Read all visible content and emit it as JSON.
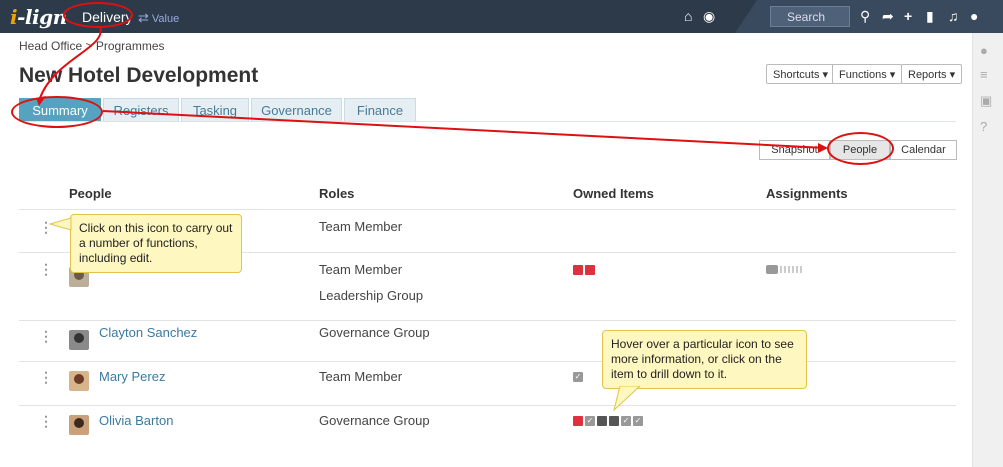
{
  "topbar": {
    "logo_prefix": "i",
    "logo_text": "-lign",
    "mode": "Delivery",
    "value_toggle": "Value",
    "search_placeholder": "Search"
  },
  "breadcrumb": "Head Office > Programmes",
  "page_title": "New Hotel Development",
  "menus": {
    "shortcuts": "Shortcuts ▾",
    "functions": "Functions ▾",
    "reports": "Reports ▾"
  },
  "tabs": [
    {
      "label": "Summary",
      "active": true
    },
    {
      "label": "Registers",
      "active": false
    },
    {
      "label": "Tasking",
      "active": false
    },
    {
      "label": "Governance",
      "active": false
    },
    {
      "label": "Finance",
      "active": false
    }
  ],
  "views": {
    "snapshot": "Snapshot",
    "people": "People",
    "calendar": "Calendar"
  },
  "table": {
    "headers": {
      "people": "People",
      "roles": "Roles",
      "owned_items": "Owned Items",
      "assignments": "Assignments"
    },
    "rows": [
      {
        "name": "",
        "roles": [
          "Team Member"
        ]
      },
      {
        "name": "",
        "roles": [
          "Team Member",
          "Leadership Group"
        ]
      },
      {
        "name": "Clayton Sanchez",
        "roles": [
          "Governance Group"
        ]
      },
      {
        "name": "Mary Perez",
        "roles": [
          "Team Member"
        ]
      },
      {
        "name": "Olivia Barton",
        "roles": [
          "Governance Group"
        ]
      }
    ]
  },
  "callouts": {
    "kebab": "Click on this icon to carry out a number of functions, including edit.",
    "hover": "Hover over a particular icon to see more information, or click on the item to drill down to it."
  },
  "colors": {
    "topbar": "#2c3a4a",
    "tab_active": "#55a2c1",
    "annotation": "#dd1111",
    "link": "#3b7aa0",
    "owned_red": "#e03040"
  }
}
